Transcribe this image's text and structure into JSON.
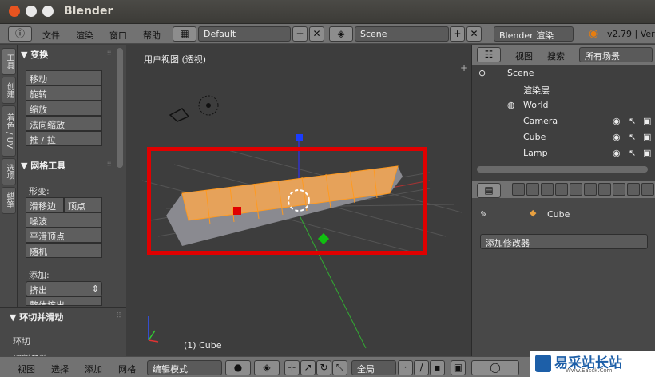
{
  "window": {
    "title": "Blender"
  },
  "info_header": {
    "menus": [
      "文件",
      "渲染",
      "窗口",
      "帮助"
    ],
    "layout": "Default",
    "scene": "Scene",
    "engine": "Blender 渲染",
    "version": "v2.79 | Ver"
  },
  "tool_tabs": [
    "工具",
    "创建",
    "着色 / UV",
    "选项",
    "蜡笔"
  ],
  "transform_panel": {
    "title": "▼ 变换",
    "buttons": [
      "移动",
      "旋转",
      "缩放",
      "法向缩放",
      "推 / 拉"
    ]
  },
  "mesh_tools_panel": {
    "title": "▼ 网格工具",
    "deform_label": "形变:",
    "buttons": [
      "滑移边",
      "顶点",
      "噪波",
      "平滑顶点",
      "随机"
    ],
    "add_label": "添加:",
    "extrude": "挤出",
    "extrude_cut": "整体挤出"
  },
  "last_operator": {
    "title": "▼ 环切并滑动",
    "item1": "环切",
    "item2": "切割参数"
  },
  "viewport": {
    "title": "用户视图 (透视)",
    "object_label": "(1) Cube"
  },
  "outliner": {
    "menus": [
      "视图",
      "搜索"
    ],
    "filter": "所有场景",
    "rows": [
      "Scene",
      "渲染层",
      "World",
      "Camera",
      "Cube",
      "Lamp"
    ]
  },
  "properties": {
    "object_name": "Cube",
    "add_modifier": "添加修改器"
  },
  "bottom_header": {
    "menus": [
      "视图",
      "选择",
      "添加",
      "网格"
    ],
    "mode": "编辑模式",
    "pivot": "全局"
  },
  "watermark": {
    "title": "易采站长站",
    "subtitle": "Www.Easck.Com"
  }
}
